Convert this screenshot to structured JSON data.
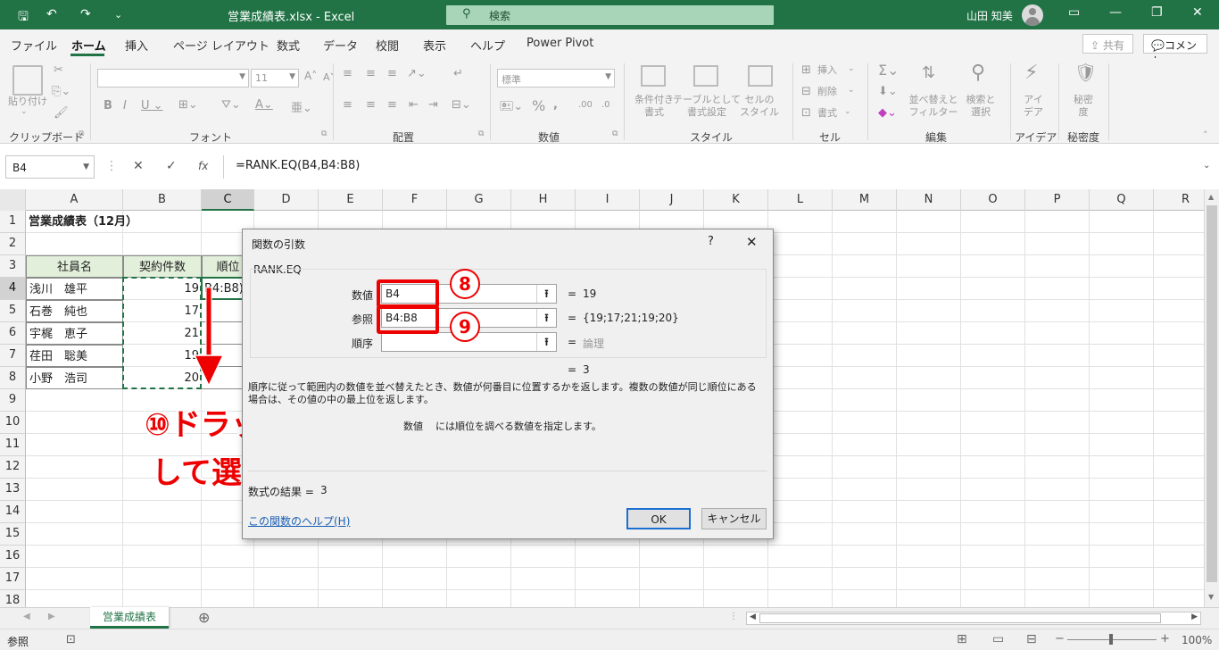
{
  "window": {
    "doc_title": "営業成績表.xlsx  -  Excel",
    "search_placeholder": "検索",
    "user_name": "山田 知美"
  },
  "tabs": [
    "ファイル",
    "ホーム",
    "挿入",
    "ページ レイアウト",
    "数式",
    "データ",
    "校閲",
    "表示",
    "ヘルプ",
    "Power Pivot"
  ],
  "ribbon_buttons": {
    "share": "共有",
    "comment": "コメント"
  },
  "ribbon": {
    "clipboard": {
      "label": "クリップボード",
      "paste": "貼り付け"
    },
    "font": {
      "label": "フォント",
      "size": "11"
    },
    "alignment": {
      "label": "配置"
    },
    "number": {
      "label": "数値",
      "format": "標準"
    },
    "styles": {
      "label": "スタイル",
      "conditional": "条件付き\n書式",
      "table": "テーブルとして\n書式設定",
      "cell_style": "セルの\nスタイル"
    },
    "cells": {
      "label": "セル",
      "insert": "挿入",
      "delete": "削除",
      "format": "書式"
    },
    "editing": {
      "label": "編集",
      "sort": "並べ替えと\nフィルター",
      "find": "検索と\n選択"
    },
    "ideas": {
      "label": "アイデア",
      "btn": "アイ\nデア"
    },
    "sensitivity": {
      "label": "秘密度",
      "btn": "秘密\n度"
    }
  },
  "formula_bar": {
    "name_box": "B4",
    "formula": "=RANK.EQ(B4,B4:B8)"
  },
  "columns": [
    "A",
    "B",
    "C",
    "D",
    "E",
    "F",
    "G",
    "H",
    "I",
    "J",
    "K",
    "L",
    "M",
    "N",
    "O",
    "P",
    "Q",
    "R"
  ],
  "rows": [
    "1",
    "2",
    "3",
    "4",
    "5",
    "6",
    "7",
    "8",
    "9",
    "10",
    "11",
    "12",
    "13",
    "14",
    "15",
    "16",
    "17",
    "18"
  ],
  "sheet": {
    "title": "営業成績表（12月）",
    "headers": [
      "社員名",
      "契約件数",
      "順位"
    ],
    "names": [
      "浅川　雄平",
      "石巻　純也",
      "宇梶　恵子",
      "荏田　聡美",
      "小野　浩司"
    ],
    "counts": [
      "19",
      "17",
      "21",
      "19",
      "20"
    ],
    "c4_text": "B4:B8)"
  },
  "dialog": {
    "title": "関数の引数",
    "help_mark": "?",
    "function_name": "RANK.EQ",
    "args": [
      {
        "label": "数値",
        "value": "B4",
        "result": "19"
      },
      {
        "label": "参照",
        "value": "B4:B8",
        "result": "{19;17;21;19;20}"
      },
      {
        "label": "順序",
        "value": "",
        "result": "論理"
      }
    ],
    "result_line": "3",
    "description": "順序に従って範囲内の数値を並べ替えたとき、数値が何番目に位置するかを返します。複数の数値が同じ順位にある場合は、その値の中の最上位を返します。",
    "arg_help_name": "数値",
    "arg_help_text": "には順位を調べる数値を指定します。",
    "formula_result_label": "数式の結果 =",
    "formula_result_value": "3",
    "help_link": "この関数のヘルプ(H)",
    "ok": "OK",
    "cancel": "キャンセル"
  },
  "annotations": {
    "badge8": "8",
    "badge9": "9",
    "drag_line1": "⑩ドラッグ",
    "drag_line2": "して選択"
  },
  "sheet_tab": "営業成績表",
  "status": {
    "mode": "参照",
    "zoom": "100%"
  },
  "colors": {
    "accent": "#217346",
    "annotation": "#ee0000",
    "header_fill": "#e2efda"
  }
}
